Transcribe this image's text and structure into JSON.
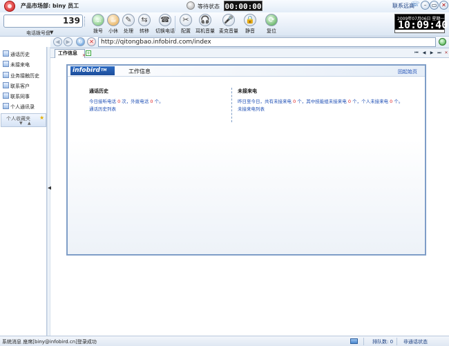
{
  "titlebar": {
    "dept_label": "产品市场部: biny 员工",
    "wait_status": "等待状态",
    "call_timer": "00:00:00",
    "contact_support": "联系远高",
    "window_buttons": {
      "minimize": "–",
      "maximize": "▭",
      "close": "✕"
    }
  },
  "toolbar": {
    "dial_value": "139",
    "dial_mode": "电话拨号盘",
    "dial_mode_arrow": "▼",
    "tools": {
      "dial": {
        "label": "拨号",
        "icon": "phone-dial-icon",
        "glyph": "☏"
      },
      "small": {
        "label": "小休",
        "icon": "coffee-cup-icon",
        "glyph": "☕"
      },
      "process": {
        "label": "处理",
        "icon": "pen-icon",
        "glyph": "✎"
      },
      "transfer": {
        "label": "转移",
        "icon": "transfer-icon",
        "glyph": "⇆"
      },
      "switch_call": {
        "label": "切换电话",
        "icon": "switch-phone-icon",
        "glyph": "☎"
      },
      "config": {
        "label": "配置",
        "icon": "tools-icon",
        "glyph": "✂"
      },
      "headset_volume": {
        "label": "耳机音量",
        "icon": "headset-icon",
        "glyph": "🎧"
      },
      "mic_volume": {
        "label": "麦克音量",
        "icon": "microphone-icon",
        "glyph": "🎤"
      },
      "mute": {
        "label": "静音",
        "icon": "lock-mute-icon",
        "glyph": "🔒"
      },
      "reset": {
        "label": "复位",
        "icon": "reset-arrows-icon",
        "glyph": "⟳"
      }
    }
  },
  "clock": {
    "date": "2009年07月06日 星期一",
    "time": "10:09:40"
  },
  "sidebar": {
    "items": [
      {
        "label": "通话历史",
        "icon": "call-history-icon"
      },
      {
        "label": "未接来电",
        "icon": "missed-call-icon"
      },
      {
        "label": "业务接触历史",
        "icon": "business-contact-icon"
      },
      {
        "label": "联系客户",
        "icon": "contact-customer-icon"
      },
      {
        "label": "联系同事",
        "icon": "contact-colleague-icon"
      },
      {
        "label": "个人通讯录",
        "icon": "address-book-icon"
      }
    ],
    "favorites": {
      "label": "个人收藏夹",
      "down": "▼",
      "up": "▲"
    },
    "splitter_arrow": "◀"
  },
  "addressbar": {
    "back": "◀",
    "forward": "▶",
    "refresh": "↻",
    "stop": "✕",
    "url": "http://qitongbao.infobird.com/index"
  },
  "tabs": {
    "items": [
      {
        "label": "工作信息",
        "close": "✕"
      }
    ],
    "add": "+",
    "nav": {
      "first": "⏮",
      "prev": "◀",
      "next": "▶",
      "last": "⏭",
      "close": "✕"
    }
  },
  "panel": {
    "logo": "infobird",
    "logo_tm": "TM",
    "title": "工作信息",
    "back_home": "回起始页",
    "call_history": {
      "title": "通话历史",
      "line1_prefix": "今日接听电话 ",
      "answered": "0",
      "line1_mid": " 次，外拨电话 ",
      "outbound": "0",
      "line1_suffix": " 个。",
      "link": "通话历史列表"
    },
    "missed_calls": {
      "title": "未接来电",
      "line1_prefix": "昨日至今日，共有未接来电 ",
      "total": "0",
      "line1_mid1": " 个，其中技能组未接来电 ",
      "skill_group": "0",
      "line1_mid2": " 个，个人未接来电 ",
      "personal": "0",
      "line1_suffix": " 个。",
      "link": "未接来电列表"
    }
  },
  "statusbar": {
    "message": "系统消息 座席[biny@infobird.cn]登录成功",
    "queue_count": "排队数: 0",
    "call_state": "非通话状态"
  },
  "colors": {
    "accent": "#1f4fb5",
    "highlight_number": "#e02020",
    "panel_border": "#7e9dc7",
    "logo_blue": "#2d6cc4"
  }
}
